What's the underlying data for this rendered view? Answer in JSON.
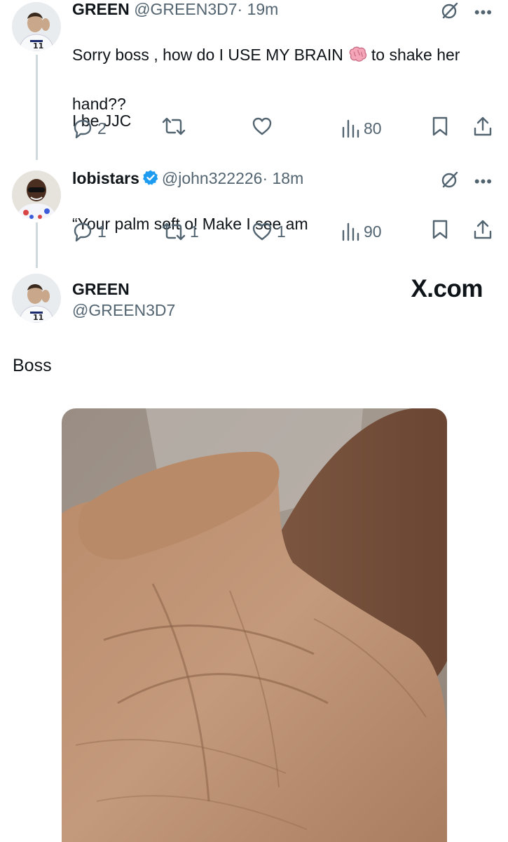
{
  "tweets": [
    {
      "name": "GREEN",
      "handle": "@GREEN3D7",
      "time": "· 19m",
      "text_line1_a": "Sorry boss , how do I USE MY BRAIN",
      "text_line1_b": "to shake her",
      "text_line2": "hand??",
      "text_line3": "I be JJC",
      "replies": "2",
      "reposts": "",
      "likes": "",
      "views": "80"
    },
    {
      "name": "lobistars",
      "handle": "@john322226",
      "time": "· 18m",
      "text": "“Your palm soft o! Make I  see am",
      "replies": "1",
      "reposts": "1",
      "likes": "1",
      "views": "90"
    }
  ],
  "main_post": {
    "name": "GREEN",
    "handle": "@GREEN3D7",
    "text": "Boss",
    "watermark": "X.com"
  },
  "colors": {
    "text": "#0f1419",
    "secondary": "#536471",
    "verified": "#1d9bf0",
    "thread_line": "#cfd9de"
  },
  "icons": [
    "grok-icon",
    "more-icon",
    "reply-icon",
    "repost-icon",
    "like-icon",
    "views-icon",
    "bookmark-icon",
    "share-icon",
    "verified-badge-icon",
    "brain-emoji-icon"
  ]
}
